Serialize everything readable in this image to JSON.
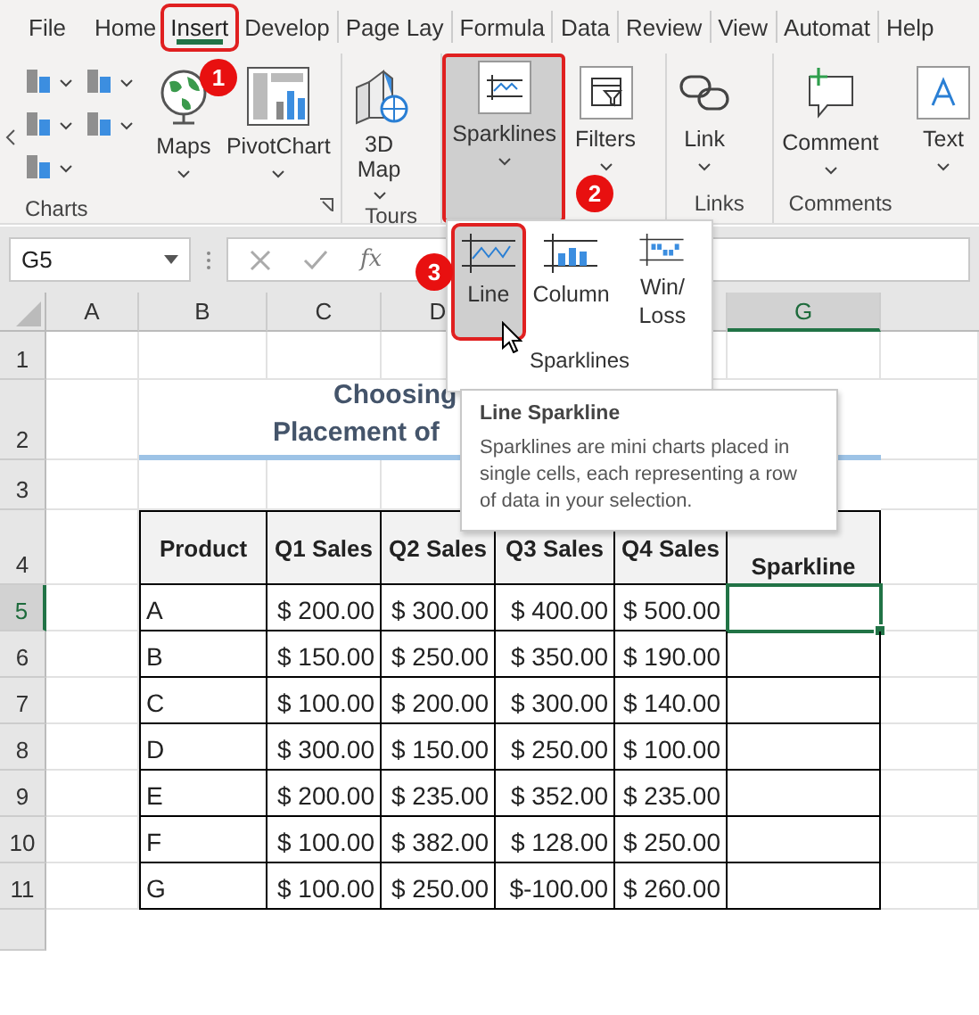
{
  "tabs": [
    {
      "label": "File",
      "selected": false,
      "highlighted": false
    },
    {
      "label": "Home",
      "selected": false,
      "highlighted": false
    },
    {
      "label": "Insert",
      "selected": true,
      "highlighted": true
    },
    {
      "label": "Develop",
      "selected": false,
      "highlighted": false
    },
    {
      "label": "Page Lay",
      "selected": false,
      "highlighted": false
    },
    {
      "label": "Formula",
      "selected": false,
      "highlighted": false
    },
    {
      "label": "Data",
      "selected": false,
      "highlighted": false
    },
    {
      "label": "Review",
      "selected": false,
      "highlighted": false
    },
    {
      "label": "View",
      "selected": false,
      "highlighted": false
    },
    {
      "label": "Automat",
      "selected": false,
      "highlighted": false
    },
    {
      "label": "Help",
      "selected": false,
      "highlighted": false
    }
  ],
  "ribbon": {
    "groups": [
      {
        "label": "Charts",
        "buttons": [
          {
            "label": "Maps",
            "kind": "globe",
            "selected": false,
            "highlighted": false
          },
          {
            "label": "PivotChart",
            "kind": "pivot",
            "selected": false,
            "highlighted": false
          }
        ]
      },
      {
        "label": "Tours",
        "buttons": [
          {
            "label": "3D Map",
            "kind": "map3d",
            "selected": false,
            "highlighted": false
          }
        ]
      },
      {
        "buttons": [
          {
            "label": "Sparklines",
            "kind": "sparkline",
            "selected": true,
            "highlighted": true
          }
        ]
      },
      {
        "buttons": [
          {
            "label": "Filters",
            "kind": "filter",
            "selected": false,
            "highlighted": false
          }
        ]
      },
      {
        "label": "Links",
        "buttons": [
          {
            "label": "Link",
            "kind": "link",
            "selected": false,
            "highlighted": false
          }
        ]
      },
      {
        "label": "Comments",
        "buttons": [
          {
            "label": "Comment",
            "kind": "comment",
            "selected": false,
            "highlighted": false
          }
        ]
      },
      {
        "buttons": [
          {
            "label": "Text",
            "kind": "text",
            "selected": false,
            "highlighted": false
          }
        ]
      }
    ]
  },
  "formula_bar": {
    "name_box": "G5",
    "function_label": "fx"
  },
  "sheet": {
    "columns": [
      {
        "label": "A",
        "selected": false
      },
      {
        "label": "B",
        "selected": false
      },
      {
        "label": "C",
        "selected": false
      },
      {
        "label": "D",
        "selected": false
      },
      {
        "label": "G",
        "selected": true
      }
    ],
    "rows": [
      {
        "label": "1",
        "selected": false
      },
      {
        "label": "2",
        "selected": false
      },
      {
        "label": "3",
        "selected": false
      },
      {
        "label": "4",
        "selected": false
      },
      {
        "label": "5",
        "selected": true
      },
      {
        "label": "6",
        "selected": false
      },
      {
        "label": "7",
        "selected": false
      },
      {
        "label": "8",
        "selected": false
      },
      {
        "label": "9",
        "selected": false
      },
      {
        "label": "10",
        "selected": false
      },
      {
        "label": "11",
        "selected": false
      }
    ],
    "title_lines": [
      "Choosing",
      "Placement of"
    ],
    "table": {
      "columns": [
        "Product",
        "Q1 Sales",
        "Q2 Sales",
        "Q3 Sales",
        "Q4 Sales",
        "Sparkline"
      ],
      "rows": [
        {
          "cells": [
            "A",
            "$ 200.00",
            "$ 300.00",
            "$ 400.00",
            "$ 500.00"
          ],
          "active": true
        },
        {
          "cells": [
            "B",
            "$ 150.00",
            "$ 250.00",
            "$ 350.00",
            "$ 190.00"
          ],
          "active": false
        },
        {
          "cells": [
            "C",
            "$ 100.00",
            "$ 200.00",
            "$ 300.00",
            "$ 140.00"
          ],
          "active": false
        },
        {
          "cells": [
            "D",
            "$ 300.00",
            "$ 150.00",
            "$ 250.00",
            "$ 100.00"
          ],
          "active": false
        },
        {
          "cells": [
            "E",
            "$ 200.00",
            "$ 235.00",
            "$ 352.00",
            "$ 235.00"
          ],
          "active": false
        },
        {
          "cells": [
            "F",
            "$ 100.00",
            "$ 382.00",
            "$ 128.00",
            "$ 250.00"
          ],
          "active": false
        },
        {
          "cells": [
            "G",
            "$ 100.00",
            "$ 250.00",
            "$-100.00",
            "$ 260.00"
          ],
          "active": false
        }
      ]
    }
  },
  "sparkline_menu": {
    "items": [
      {
        "label": "Line",
        "kind": "line",
        "selected": true,
        "highlighted": true
      },
      {
        "label": "Column",
        "kind": "column",
        "selected": false,
        "highlighted": false
      },
      {
        "label": "Win/ Loss",
        "kind": "winloss",
        "selected": false,
        "highlighted": false
      }
    ],
    "group_label": "Sparklines"
  },
  "tooltip": {
    "title": "Line Sparkline",
    "body": "Sparklines are mini charts placed in single cells, each representing a row of data in your selection."
  },
  "callouts": [
    "1",
    "2",
    "3"
  ]
}
